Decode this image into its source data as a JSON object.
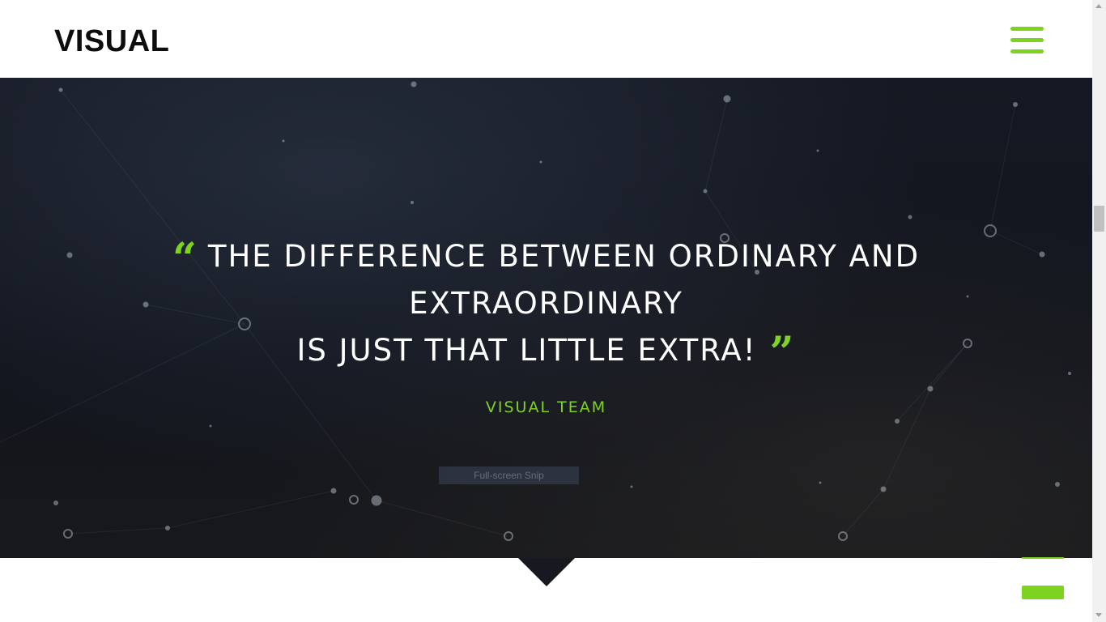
{
  "header": {
    "logo": "VISUAL",
    "menu_icon": "hamburger-menu-icon"
  },
  "hero": {
    "quote_open_icon": "quote-open-icon",
    "quote_close_icon": "quote-close-icon",
    "quote_line1": "THE DIFFERENCE BETWEEN ORDINARY AND",
    "quote_line2": "EXTRAORDINARY",
    "quote_line3": "IS JUST THAT LITTLE EXTRA!",
    "author": "VISUAL TEAM",
    "snip_label": "Full-screen Snip"
  },
  "colors": {
    "accent": "#7ed321",
    "hero_bg": "#151923",
    "text_light": "#ffffff",
    "logo_text": "#0d0d0d"
  },
  "footer": {
    "scroll_top_icon": "scroll-to-top-icon"
  }
}
